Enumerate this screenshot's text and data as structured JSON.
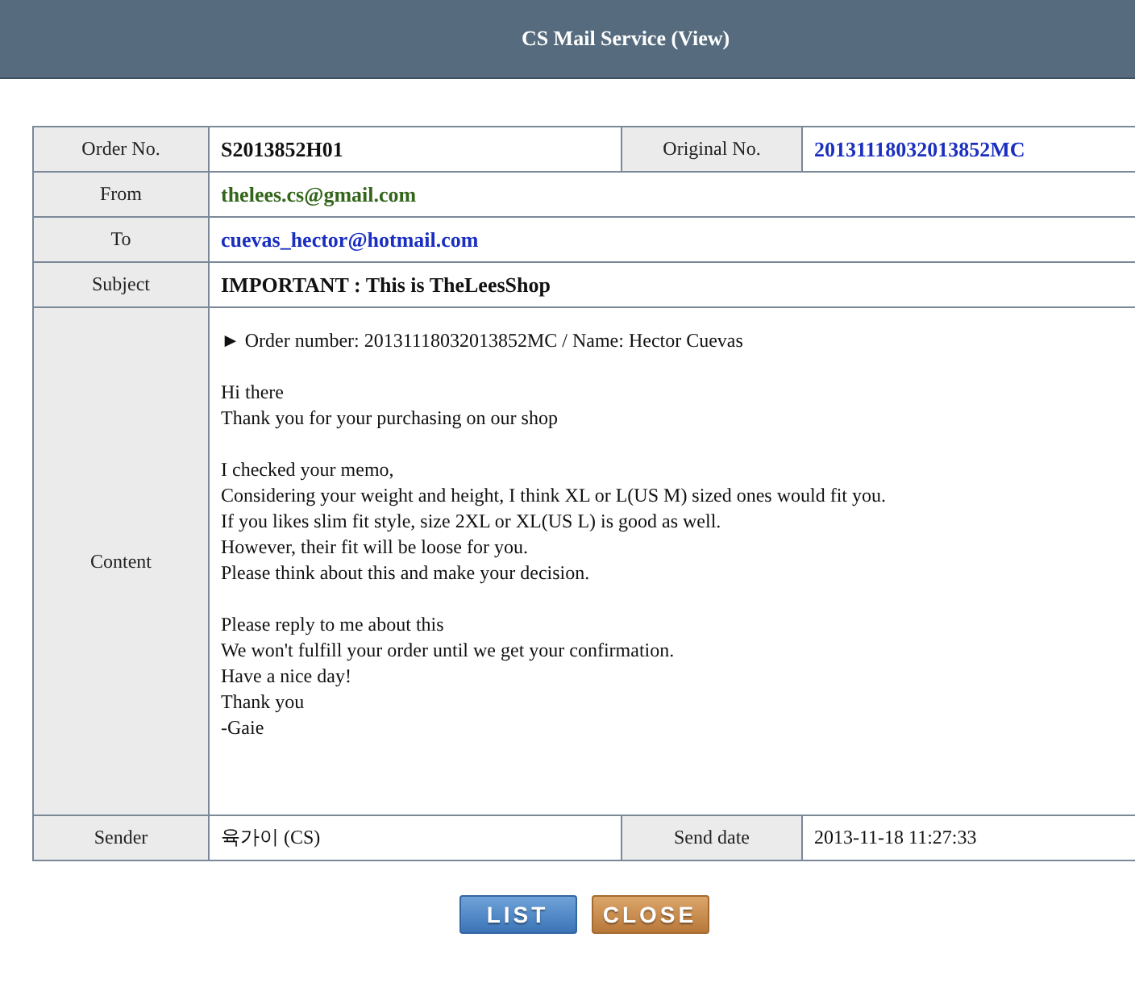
{
  "window": {
    "title": "CS Mail Service (View)"
  },
  "order_no": {
    "label": "Order No.",
    "value": "S2013852H01"
  },
  "original_no": {
    "label": "Original No.",
    "value": "20131118032013852MC"
  },
  "from": {
    "label": "From",
    "value": "thelees.cs@gmail.com"
  },
  "to": {
    "label": "To",
    "value": "cuevas_hector@hotmail.com"
  },
  "subject": {
    "label": "Subject",
    "value": "IMPORTANT : This is TheLeesShop"
  },
  "content": {
    "label": "Content",
    "paragraphs": [
      "► Order number: 20131118032013852MC / Name: Hector Cuevas",
      "Hi there\nThank you for your purchasing on our shop",
      "I checked your memo,\nConsidering your weight and height, I think XL or L(US M) sized ones would fit you.\nIf you likes slim fit style, size 2XL or XL(US L) is good as well.\nHowever, their fit will be loose for you.\nPlease think about this and make your decision.",
      "Please reply to me about this\nWe won't fulfill your order until we get your confirmation.\nHave a nice day!\nThank you\n-Gaie"
    ]
  },
  "sender": {
    "label": "Sender",
    "value": "육가이 (CS)"
  },
  "send_date": {
    "label": "Send date",
    "value": "2013-11-18 11:27:33"
  },
  "buttons": [
    {
      "label": "LIST",
      "kind": "list"
    },
    {
      "label": "CLOSE",
      "kind": "close"
    }
  ]
}
